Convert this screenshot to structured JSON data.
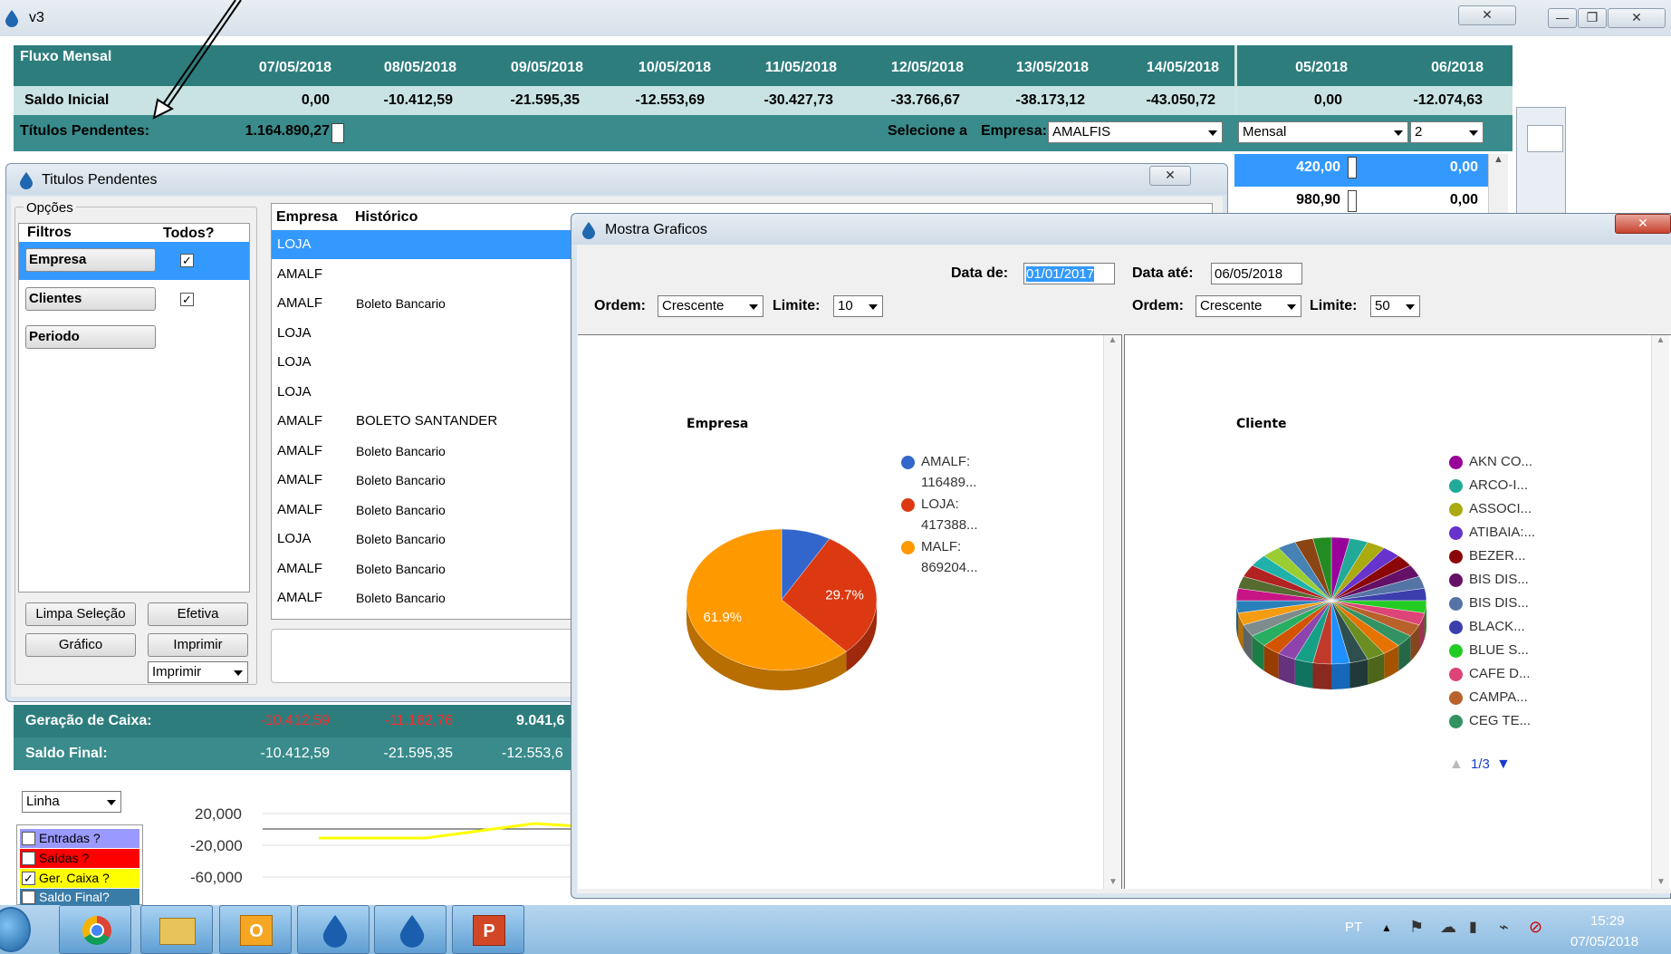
{
  "main_window": {
    "title": "v3",
    "header": {
      "fluxo_label": "Fluxo Mensal",
      "dates": [
        "07/05/2018",
        "08/05/2018",
        "09/05/2018",
        "10/05/2018",
        "11/05/2018",
        "12/05/2018",
        "13/05/2018",
        "14/05/2018"
      ],
      "months": [
        "05/2018",
        "06/2018"
      ]
    },
    "saldo_inicial": {
      "label": "Saldo Inicial",
      "values": [
        "0,00",
        "-10.412,59",
        "-21.595,35",
        "-12.553,69",
        "-30.427,73",
        "-33.766,67",
        "-38.173,12",
        "-43.050,72"
      ],
      "month_values": [
        "0,00",
        "-12.074,63"
      ]
    },
    "titulos": {
      "label": "Títulos Pendentes:",
      "value": "1.164.890,27",
      "selecione_label": "Selecione a",
      "empresa_label": "Empresa:",
      "empresa_value": "AMALFIS",
      "periodo_value": "Mensal",
      "num_value": "2"
    },
    "right_values": [
      [
        "420,00",
        "0,00"
      ],
      [
        "980,90",
        "0,00"
      ]
    ],
    "geracao": {
      "label": "Geração de Caixa:",
      "values": [
        "-10.412,59",
        "-11.182,76",
        "9.041,6"
      ]
    },
    "saldo_final": {
      "label": "Saldo Final:",
      "values": [
        "-10.412,59",
        "-21.595,35",
        "-12.553,6"
      ]
    },
    "chart_type": "Linha",
    "y_ticks": [
      "20,000",
      "-20,000",
      "-60,000"
    ],
    "series_checks": [
      {
        "label": "Entradas ?",
        "color": "#9999ff",
        "checked": false
      },
      {
        "label": "Saídas ?",
        "color": "#ff0000",
        "checked": false
      },
      {
        "label": "Ger. Caixa ?",
        "color": "#ffff00",
        "checked": true
      },
      {
        "label": "Saldo Final?",
        "color": "#3a7ca8",
        "checked": false
      }
    ]
  },
  "titulos_window": {
    "title": "Titulos Pendentes",
    "opcoes_label": "Opções",
    "filtros_header": "Filtros",
    "todos_header": "Todos?",
    "filters": [
      {
        "label": "Empresa",
        "checked": true
      },
      {
        "label": "Clientes",
        "checked": true
      },
      {
        "label": "Periodo",
        "checked": null
      }
    ],
    "buttons": {
      "limpa": "Limpa Seleção",
      "efetiva": "Efetiva",
      "grafico": "Gráfico",
      "imprimir": "Imprimir",
      "imprimir_combo": "Imprimir"
    },
    "grid_headers": [
      "Empresa",
      "Histórico"
    ],
    "rows": [
      {
        "empresa": "LOJA",
        "historico": ""
      },
      {
        "empresa": "AMALF",
        "historico": ""
      },
      {
        "empresa": "AMALF",
        "historico": "Boleto Bancario"
      },
      {
        "empresa": "LOJA",
        "historico": ""
      },
      {
        "empresa": "LOJA",
        "historico": ""
      },
      {
        "empresa": "LOJA",
        "historico": ""
      },
      {
        "empresa": "AMALF",
        "historico": "BOLETO SANTANDER"
      },
      {
        "empresa": "AMALF",
        "historico": "Boleto Bancario"
      },
      {
        "empresa": "AMALF",
        "historico": "Boleto Bancario"
      },
      {
        "empresa": "AMALF",
        "historico": "Boleto Bancario"
      },
      {
        "empresa": "LOJA",
        "historico": "Boleto Bancario"
      },
      {
        "empresa": "AMALF",
        "historico": "Boleto Bancario"
      },
      {
        "empresa": "AMALF",
        "historico": "Boleto Bancario"
      }
    ]
  },
  "graficos_window": {
    "title": "Mostra Graficos",
    "data_de_label": "Data de:",
    "data_de_value": "01/01/2017",
    "data_ate_label": "Data até:",
    "data_ate_value": "06/05/2018",
    "ordem_label": "Ordem:",
    "limite_label": "Limite:",
    "left_ordem": "Crescente",
    "left_limite": "10",
    "right_ordem": "Crescente",
    "right_limite": "50",
    "empresa_title": "Empresa",
    "cliente_title": "Cliente",
    "pager": "1/3"
  },
  "chart_data": [
    {
      "type": "pie",
      "title": "Empresa",
      "labels": [
        "AMALF",
        "LOJA",
        "MALF"
      ],
      "legend": [
        "AMALF:",
        "116489...",
        "LOJA:",
        "417388...",
        "MALF:",
        "869204..."
      ],
      "values": [
        8.4,
        29.7,
        61.9
      ],
      "data_labels": [
        "29.7%",
        "61.9%"
      ],
      "colors": [
        "#3366cc",
        "#dc3912",
        "#ff9900"
      ]
    },
    {
      "type": "pie",
      "title": "Cliente",
      "labels": [
        "AKN CO...",
        "ARCO-I...",
        "ASSOCI...",
        "ATIBAIA:...",
        "BEZER...",
        "BIS DIS...",
        "BIS DIS...",
        "BLACK...",
        "BLUE S...",
        "CAFE D...",
        "CAMPA...",
        "CEG TE..."
      ],
      "colors": [
        "#990099",
        "#22aa99",
        "#aaaa11",
        "#6633cc",
        "#8b0707",
        "#651067",
        "#5574a6",
        "#3b3eac",
        "#22cc22",
        "#dd4477",
        "#b8612a",
        "#329262"
      ]
    }
  ],
  "taskbar": {
    "lang": "PT",
    "time": "15:29",
    "date": "07/05/2018"
  }
}
